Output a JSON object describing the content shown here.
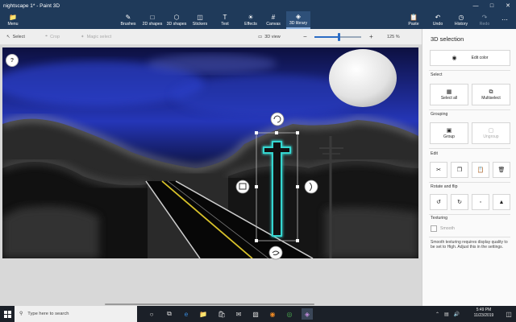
{
  "window": {
    "title": "nightscape 1* - Paint 3D"
  },
  "ribbon": {
    "menu": "Menu",
    "brushes": "Brushes",
    "shapes2d": "2D shapes",
    "shapes3d": "3D shapes",
    "stickers": "Stickers",
    "text": "Text",
    "effects": "Effects",
    "canvas": "Canvas",
    "library": "3D library",
    "paste": "Paste",
    "undo": "Undo",
    "history": "History",
    "redo": "Redo"
  },
  "toolbar": {
    "select": "Select",
    "crop": "Crop",
    "magic_select": "Magic select",
    "view3d": "3D view",
    "zoom": "125 %",
    "zoom_level": 0.52
  },
  "help": "?",
  "panel": {
    "title": "3D selection",
    "edit_color": "Edit color",
    "select_section": "Select",
    "select_all": "Select all",
    "multiselect": "Multiselect",
    "grouping": "Grouping",
    "group": "Group",
    "ungroup": "Ungroup",
    "edit": "Edit",
    "rotate_flip": "Rotate and flip",
    "texturing": "Texturing",
    "smooth": "Smooth",
    "note": "Smooth texturing requires display quality to be set to High. Adjust this in the settings."
  },
  "taskbar": {
    "search_placeholder": "Type here to search",
    "time": "5:49 PM",
    "date": "11/23/2019"
  },
  "colors": {
    "titlebar": "#1f3a5a",
    "accent": "#2b6cc4",
    "cross": "#35d6d0"
  }
}
